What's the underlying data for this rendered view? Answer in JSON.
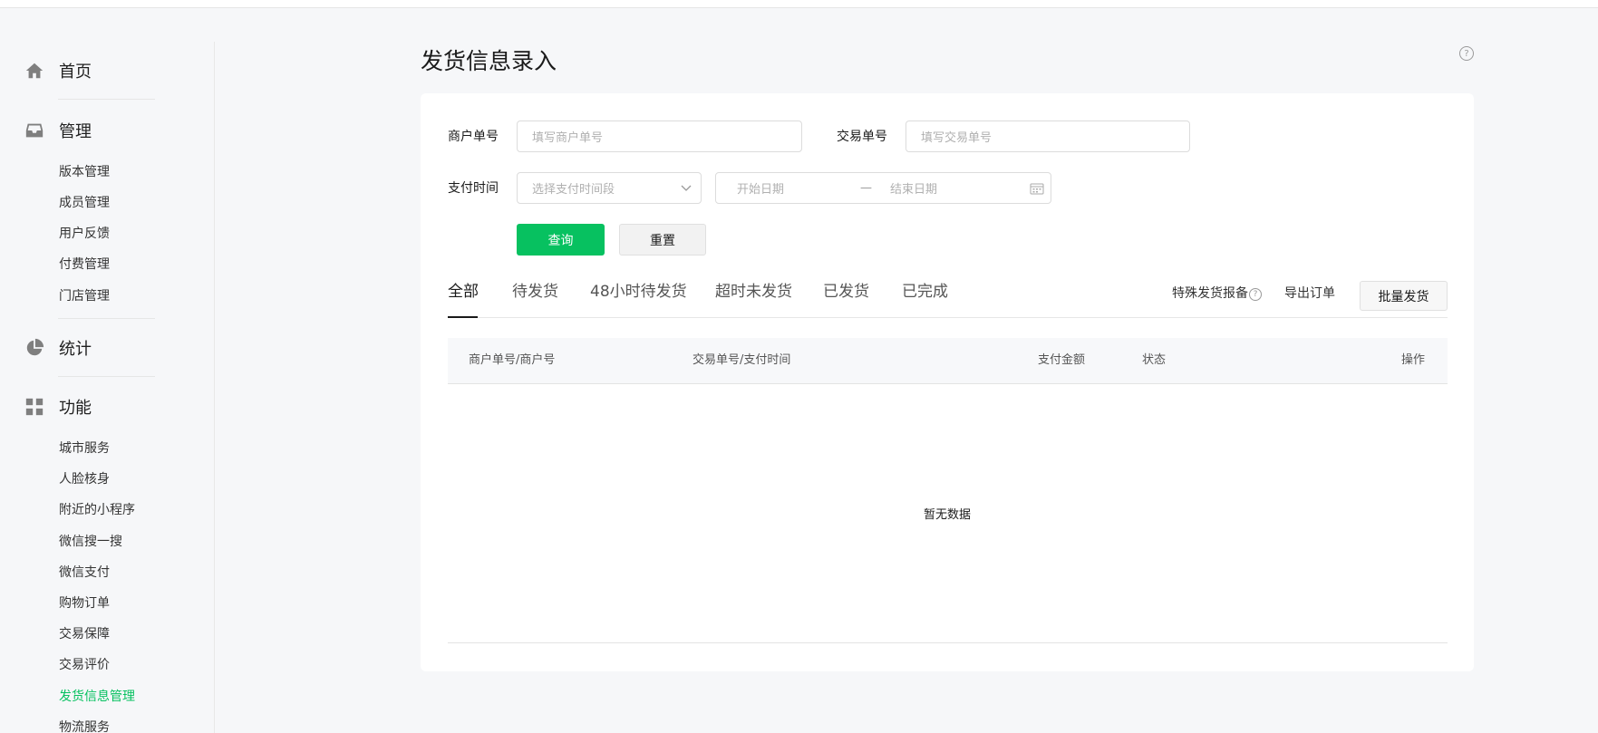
{
  "sidebar": {
    "groups": [
      {
        "title": "首页",
        "icon": "home-icon"
      },
      {
        "title": "管理",
        "icon": "inbox-icon"
      },
      {
        "title": "统计",
        "icon": "pie-chart-icon"
      },
      {
        "title": "功能",
        "icon": "grid-icon"
      }
    ],
    "manage_items": [
      "版本管理",
      "成员管理",
      "用户反馈",
      "付费管理",
      "门店管理"
    ],
    "feature_items": [
      "城市服务",
      "人脸核身",
      "附近的小程序",
      "微信搜一搜",
      "微信支付",
      "购物订单",
      "交易保障",
      "交易评价",
      "发货信息管理",
      "物流服务"
    ],
    "active_item": "发货信息管理"
  },
  "header": {
    "title": "发货信息录入",
    "help_icon": "question-circle-icon",
    "help_glyph": "?"
  },
  "filters": {
    "merchant_label": "商户单号",
    "merchant_placeholder": "填写商户单号",
    "trade_label": "交易单号",
    "trade_placeholder": "填写交易单号",
    "paytime_label": "支付时间",
    "paytime_select_placeholder": "选择支付时间段",
    "start_date_placeholder": "开始日期",
    "date_separator": "—",
    "end_date_placeholder": "结束日期",
    "query_button": "查询",
    "reset_button": "重置"
  },
  "tabs": [
    "全部",
    "待发货",
    "48小时待发货",
    "超时未发货",
    "已发货",
    "已完成"
  ],
  "active_tab": "全部",
  "toolbar": {
    "special_report": "特殊发货报备",
    "export": "导出订单",
    "batch_ship": "批量发货"
  },
  "table": {
    "columns": [
      "商户单号/商户号",
      "交易单号/支付时间",
      "支付金额",
      "状态",
      "操作"
    ],
    "empty_text": "暂无数据"
  },
  "colors": {
    "accent": "#07c160",
    "background": "#f6f7f9"
  }
}
